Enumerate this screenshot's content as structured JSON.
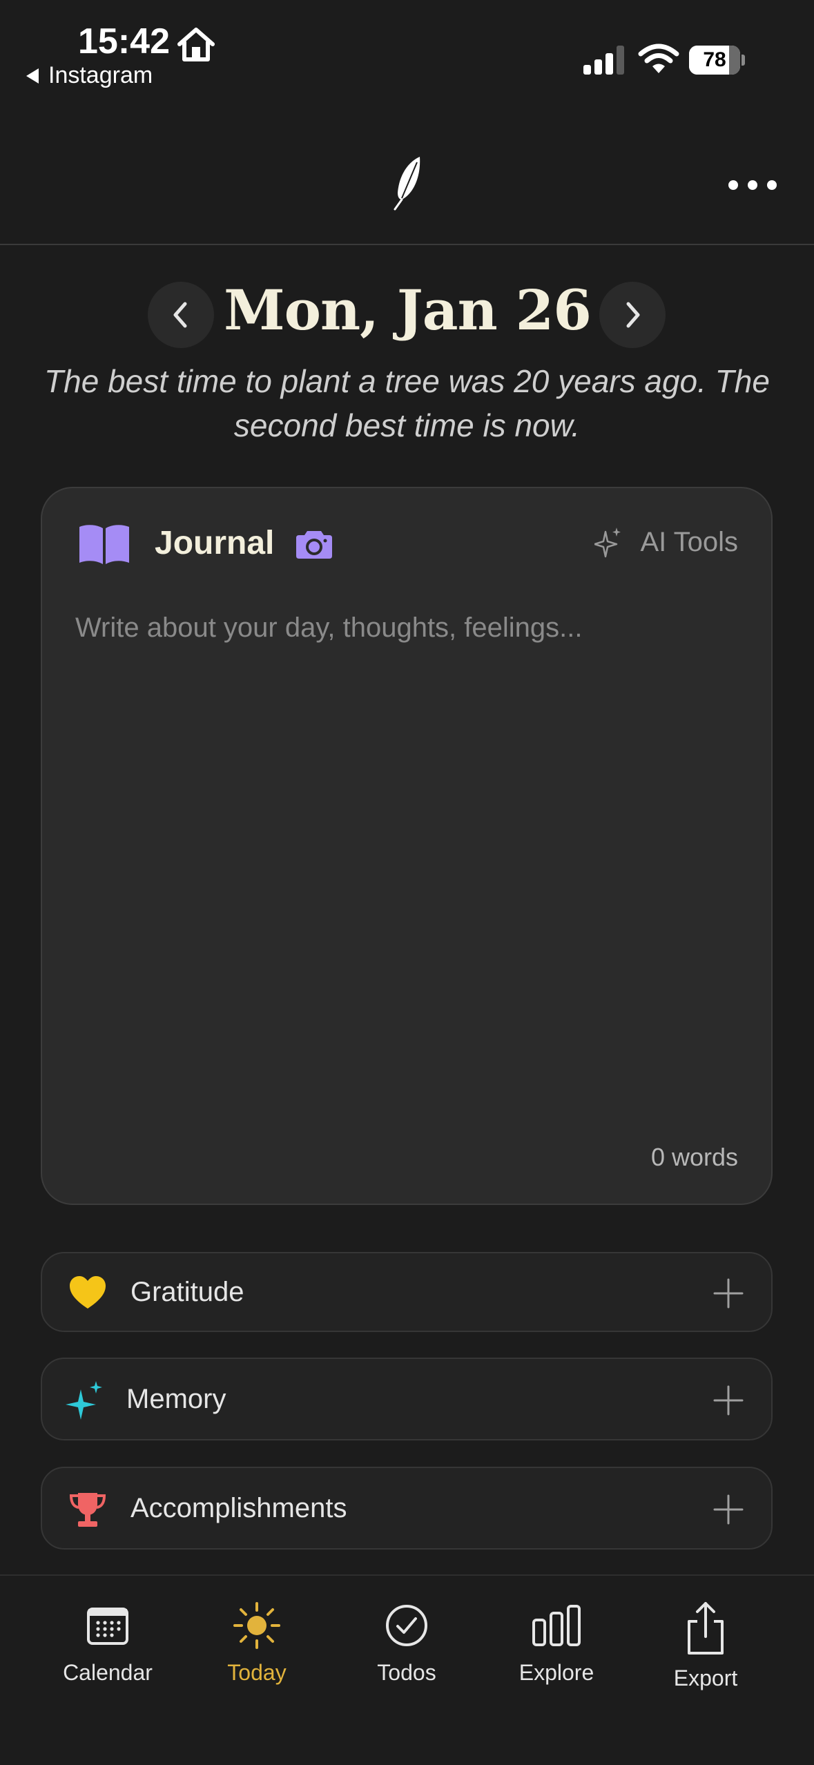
{
  "status_bar": {
    "time": "15:42",
    "back_label": "Instagram",
    "battery_level": 78,
    "battery_text": "78"
  },
  "header": {
    "logo_icon": "feather-icon",
    "more_icon": "more-dots-icon"
  },
  "date_nav": {
    "date": "Mon, Jan 26",
    "prev_icon": "chevron-left-icon",
    "next_icon": "chevron-right-icon"
  },
  "quote": "The best time to plant a tree was 20 years ago. The second best time is now.",
  "journal": {
    "title": "Journal",
    "ai_tools_label": "AI Tools",
    "placeholder": "Write about your day, thoughts, feelings...",
    "value": "",
    "word_count": "0 words",
    "accent_color": "#a58cf5"
  },
  "sections": [
    {
      "label": "Gratitude",
      "icon": "heart-icon",
      "color": "#f5c518"
    },
    {
      "label": "Memory",
      "icon": "sparkles-icon",
      "color": "#2ec9d8"
    },
    {
      "label": "Accomplishments",
      "icon": "trophy-icon",
      "color": "#f06464"
    }
  ],
  "tabs": [
    {
      "label": "Calendar",
      "icon": "calendar-icon",
      "active": false
    },
    {
      "label": "Today",
      "icon": "sun-icon",
      "active": true
    },
    {
      "label": "Todos",
      "icon": "check-circle-icon",
      "active": false
    },
    {
      "label": "Explore",
      "icon": "bar-chart-icon",
      "active": false
    },
    {
      "label": "Export",
      "icon": "share-icon",
      "active": false
    }
  ],
  "colors": {
    "background": "#1c1c1c",
    "card": "#2b2b2b",
    "title_cream": "#f3efdc",
    "active_tab": "#e2b33c"
  }
}
